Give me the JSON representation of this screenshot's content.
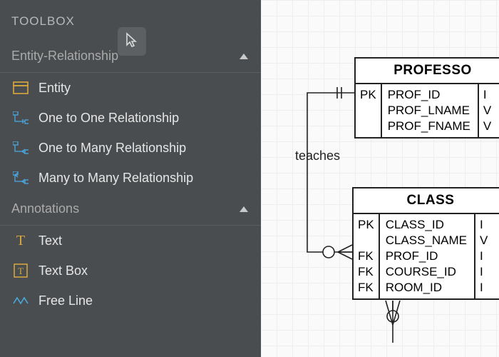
{
  "sidebar": {
    "title": "TOOLBOX",
    "sections": [
      {
        "label": "Entity-Relationship",
        "items": [
          {
            "label": "Entity"
          },
          {
            "label": "One to One Relationship"
          },
          {
            "label": "One to Many Relationship"
          },
          {
            "label": "Many to Many Relationship"
          }
        ]
      },
      {
        "label": "Annotations",
        "items": [
          {
            "label": "Text"
          },
          {
            "label": "Text Box"
          },
          {
            "label": "Free Line"
          }
        ]
      }
    ]
  },
  "diagram": {
    "relationships": [
      {
        "label": "teaches"
      }
    ],
    "entities": [
      {
        "name": "PROFESSOR",
        "name_visible": "PROFESSO",
        "rows": [
          {
            "key": "PK",
            "attr": "PROF_ID",
            "type_visible": "I"
          },
          {
            "key": "",
            "attr": "PROF_LNAME",
            "type_visible": "V"
          },
          {
            "key": "",
            "attr": "PROF_FNAME",
            "type_visible": "V"
          }
        ]
      },
      {
        "name": "CLASS",
        "name_visible": "CLASS",
        "rows": [
          {
            "key": "PK",
            "attr": "CLASS_ID",
            "type_visible": "I"
          },
          {
            "key": "",
            "attr": "CLASS_NAME",
            "type_visible": "V"
          },
          {
            "key": "FK",
            "attr": "PROF_ID",
            "type_visible": "I"
          },
          {
            "key": "FK",
            "attr": "COURSE_ID",
            "type_visible": "I"
          },
          {
            "key": "FK",
            "attr": "ROOM_ID",
            "type_visible": "I"
          }
        ]
      }
    ]
  }
}
